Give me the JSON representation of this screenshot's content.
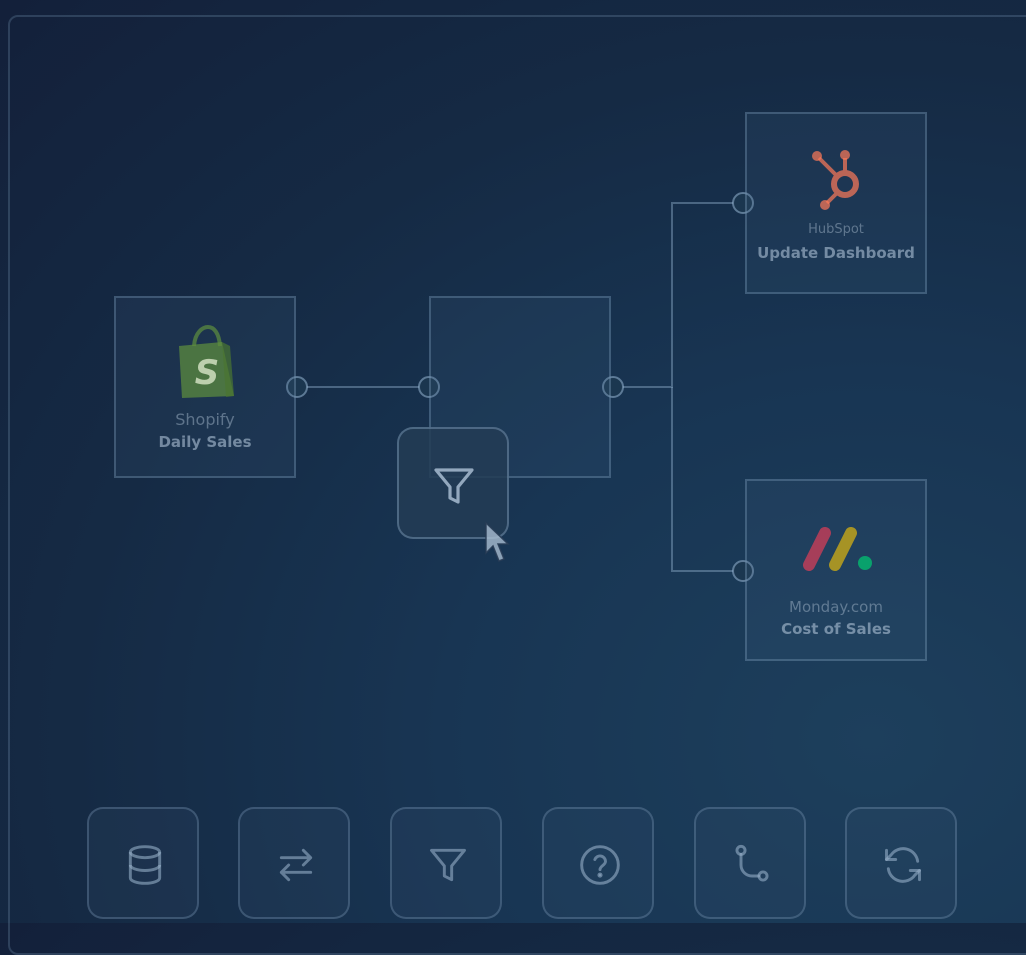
{
  "nodes": {
    "shopify": {
      "app": "Shopify",
      "title": "Daily Sales",
      "logo": "shopify-bag-logo"
    },
    "hubspot": {
      "app": "HubSpot",
      "title": "Update Dashboard",
      "logo": "hubspot-sprocket-logo"
    },
    "monday": {
      "app": "Monday.com",
      "title": "Cost of Sales",
      "logo": "monday-logo"
    },
    "middle": {
      "state": "empty"
    }
  },
  "dragged_item": {
    "icon": "filter-icon"
  },
  "toolbar": {
    "items": [
      {
        "icon": "database-icon"
      },
      {
        "icon": "transfer-arrows-icon"
      },
      {
        "icon": "filter-icon"
      },
      {
        "icon": "help-circle-icon"
      },
      {
        "icon": "branch-icon"
      },
      {
        "icon": "refresh-icon"
      }
    ]
  },
  "colors": {
    "background": "#152a44",
    "shopify_green": "#5e8e3e",
    "hubspot_orange": "#ff7a59",
    "monday_red": "#ff3d57",
    "monday_yellow": "#ffcb00",
    "monday_green": "#00ca72"
  }
}
